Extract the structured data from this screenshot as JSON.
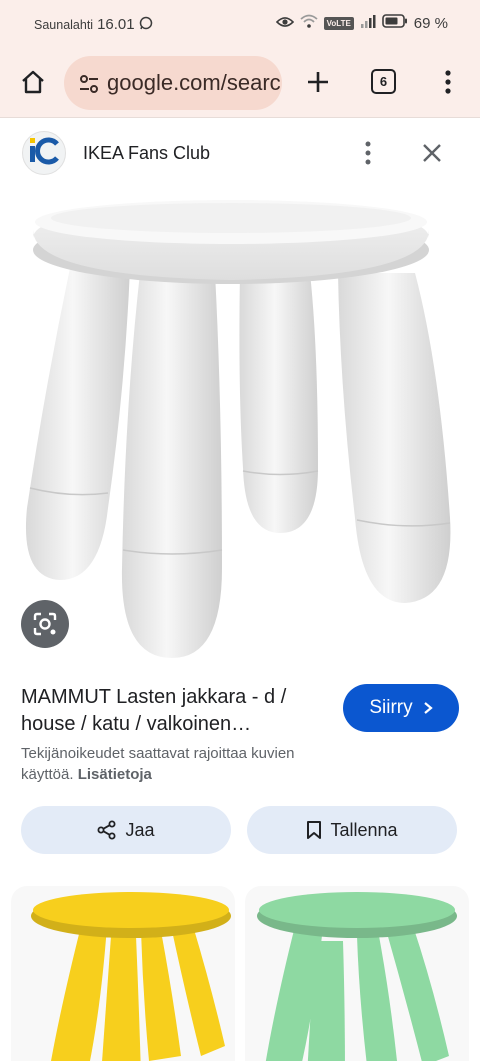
{
  "status_bar": {
    "carrier": "Saunalahti",
    "time": "16.01",
    "network_badge": "VoLTE",
    "battery": "69 %"
  },
  "browser": {
    "url": "google.com/search",
    "tab_count": "6",
    "icons": {
      "home": "home-icon",
      "site_settings": "tune-icon",
      "new_tab": "plus-icon",
      "menu": "more-vert-icon"
    }
  },
  "source": {
    "favicon_text": "iC",
    "name": "IKEA Fans Club"
  },
  "result": {
    "title": "MAMMUT Lasten jakkara - d / house / katu / valkoinen…",
    "go_label": "Siirry",
    "copyright_text": "Tekijänoikeudet saattavat rajoittaa kuvien käyttöä.",
    "learn_more": "Lisätietoja"
  },
  "actions": {
    "share_label": "Jaa",
    "save_label": "Tallenna"
  },
  "related": [
    {
      "color": "#f7cf1d"
    },
    {
      "color": "#8ed9a2"
    }
  ],
  "colors": {
    "accent": "#0b57d0",
    "chrome_bg": "#fbeeea",
    "url_bg": "#f6d9cf",
    "action_bg": "#e3ebf7"
  }
}
